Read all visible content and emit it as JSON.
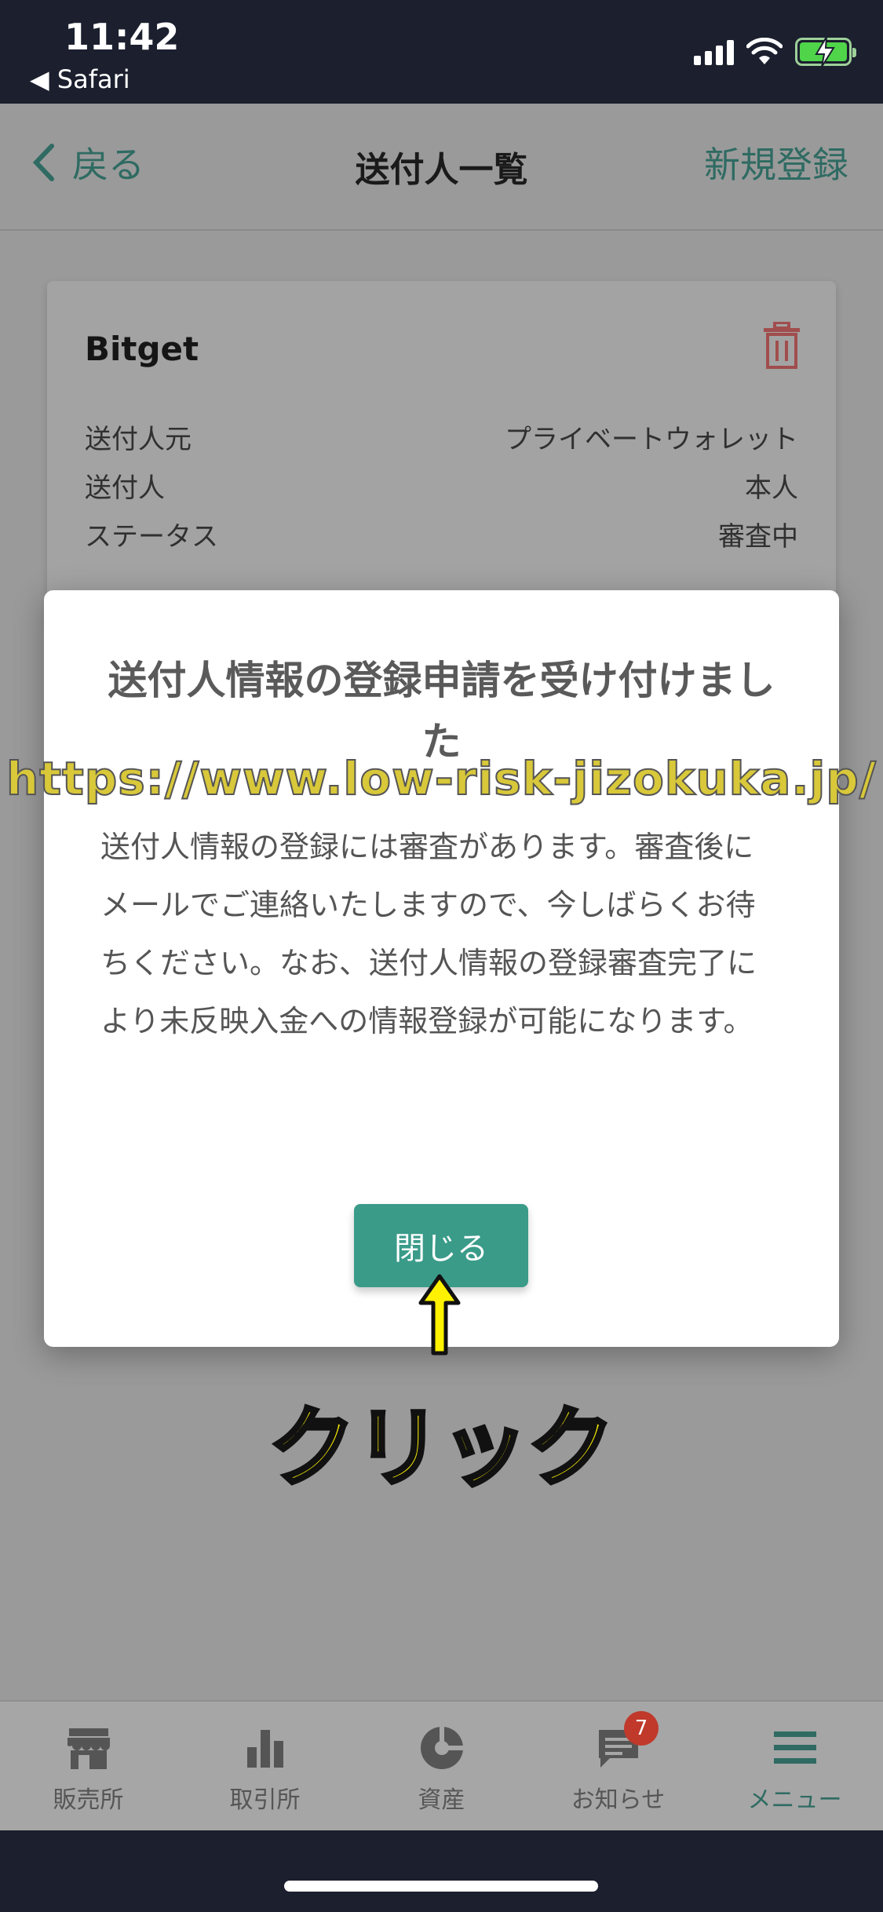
{
  "status": {
    "time": "11:42",
    "back_app": "◀ Safari"
  },
  "nav": {
    "back_label": "戻る",
    "title": "送付人一覧",
    "new_label": "新規登録"
  },
  "card": {
    "title": "Bitget",
    "rows": [
      {
        "label": "送付人元",
        "value": "プライベートウォレット"
      },
      {
        "label": "送付人",
        "value": "本人"
      },
      {
        "label": "ステータス",
        "value": "審査中"
      }
    ]
  },
  "modal": {
    "title": "送付人情報の登録申請を受け付けました",
    "body": "送付人情報の登録には審査があります。審査後にメールでご連絡いたしますので、今しばらくお待ちください。なお、送付人情報の登録審査完了により未反映入金への情報登録が可能になります。",
    "close_label": "閉じる"
  },
  "overlay": {
    "watermark": "https://www.low-risk-jizokuka.jp/",
    "click_label": "クリック"
  },
  "tabbar": {
    "items": [
      {
        "label": "販売所",
        "icon": "store-icon"
      },
      {
        "label": "取引所",
        "icon": "bar-chart-icon"
      },
      {
        "label": "資産",
        "icon": "pie-chart-icon"
      },
      {
        "label": "お知らせ",
        "icon": "message-icon",
        "badge": "7"
      },
      {
        "label": "メニュー",
        "icon": "menu-icon",
        "active": true
      }
    ]
  },
  "colors": {
    "accent": "#3a9b89",
    "dim_overlay": "#9a9a9a",
    "badge": "#c0392b"
  }
}
